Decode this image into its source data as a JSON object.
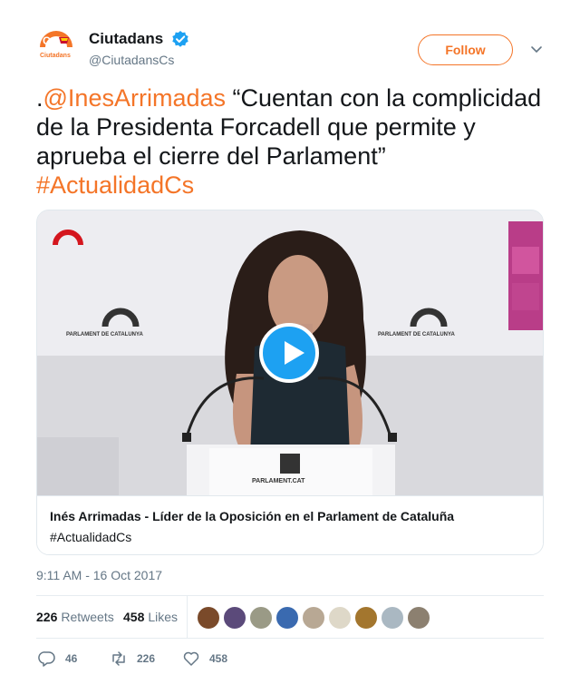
{
  "account": {
    "display_name": "Ciutadans",
    "handle": "@CiutadansCs",
    "follow_label": "Follow",
    "avatar_text": "Ciutadans",
    "avatar_logo": "Cs"
  },
  "tweet": {
    "lead_punct": ".",
    "mention": "@InesArrimadas",
    "body": " “Cuentan con la complicidad de la Presidenta Forcadell que permite y aprueba el cierre del Parlament” ",
    "hashtag": "#ActualidadCs"
  },
  "card": {
    "title": "Inés Arrimadas - Líder de la Oposición en el Parlament de Cataluña",
    "description": "#ActualidadCs",
    "backdrop_text": "PARLAMENT DE CATALUNYA",
    "lectern_text": "PARLAMENT.CAT"
  },
  "timestamp": "9:11 AM - 16 Oct 2017",
  "stats": {
    "retweets_count": "226",
    "retweets_label": "Retweets",
    "likes_count": "458",
    "likes_label": "Likes"
  },
  "actions": {
    "replies": "46",
    "retweets": "226",
    "likes": "458"
  },
  "colors": {
    "brand_orange": "#f47528",
    "verified_blue": "#1da1f2",
    "muted_text": "#657786"
  },
  "icons": [
    "verified-badge-icon",
    "chevron-down-icon",
    "play-icon",
    "reply-icon",
    "retweet-icon",
    "heart-icon"
  ]
}
